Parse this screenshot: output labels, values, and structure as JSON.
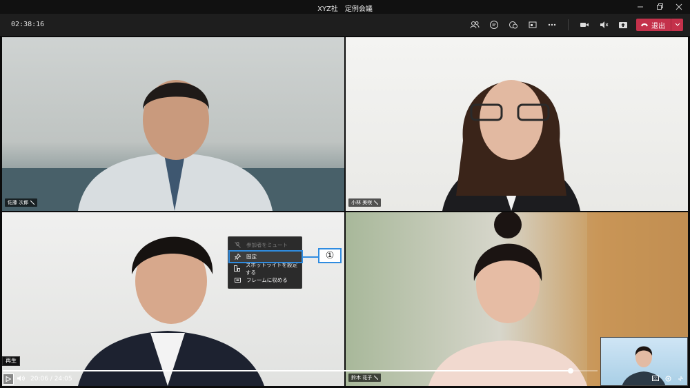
{
  "window": {
    "title": "XYZ社　定例会議"
  },
  "toolbar": {
    "timer": "02:38:16",
    "leave_label": "退出"
  },
  "participants": [
    {
      "name": "佐藤 次郎"
    },
    {
      "name": "小林 美咲"
    },
    {
      "name": ""
    },
    {
      "name": "鈴木 花子"
    }
  ],
  "context_menu": {
    "items": [
      {
        "label": "参加者をミュート",
        "icon": "mic-off-icon",
        "disabled": true
      },
      {
        "label": "固定",
        "icon": "pin-icon",
        "disabled": false
      },
      {
        "label": "スポットライトを設定する",
        "icon": "spotlight-icon",
        "disabled": false
      },
      {
        "label": "フレームに収める",
        "icon": "fit-frame-icon",
        "disabled": false
      }
    ]
  },
  "annotation": {
    "marker": "①",
    "color": "#2f8ce0"
  },
  "player": {
    "tooltip": "再生",
    "time": "20:06 / 24:05",
    "progress": 0.955
  },
  "colors": {
    "leave": "#c4314b",
    "toolbar": "#1e1e1e"
  }
}
